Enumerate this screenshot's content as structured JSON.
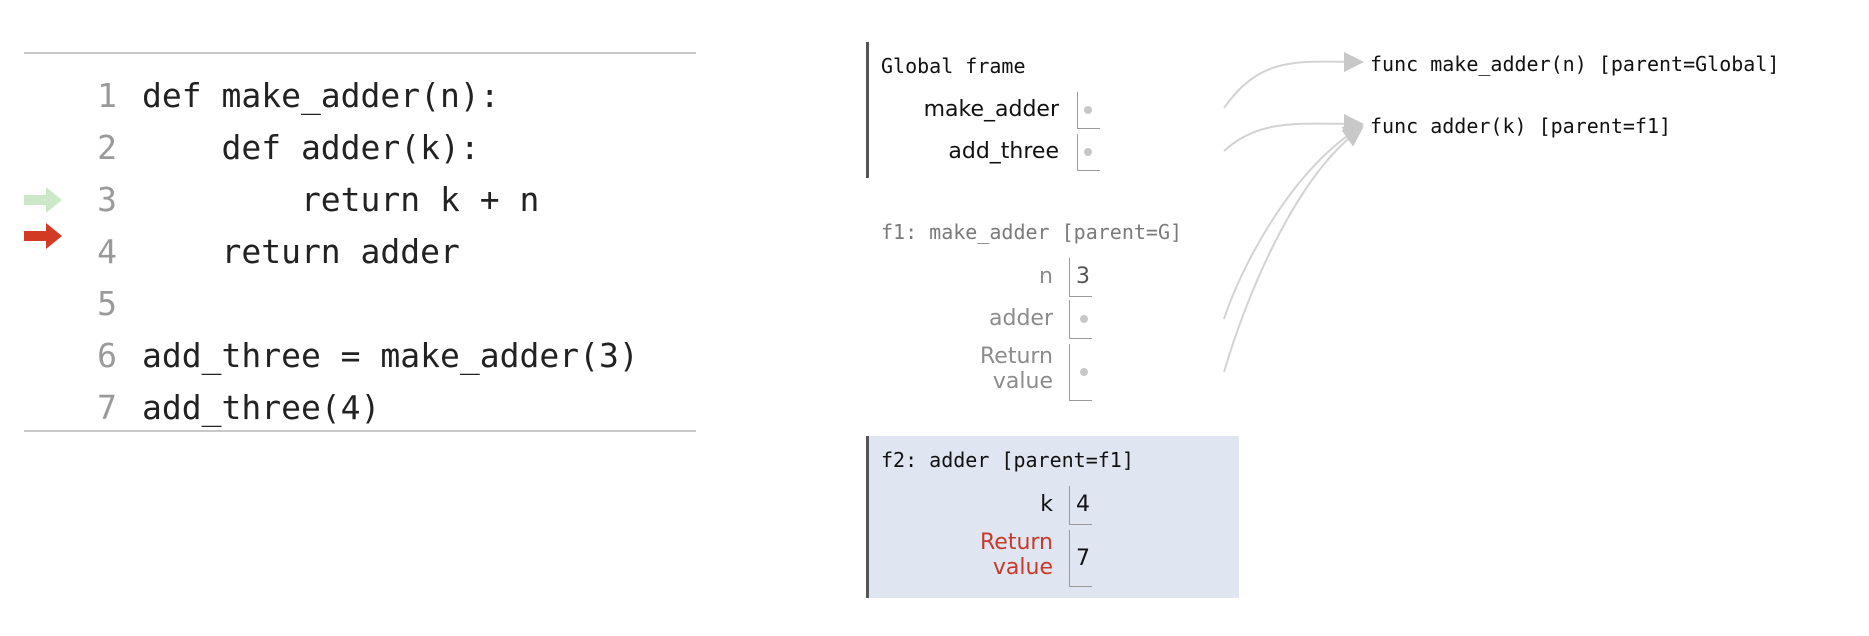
{
  "code": {
    "lines": [
      {
        "num": "1",
        "text": "def make_adder(n):"
      },
      {
        "num": "2",
        "text": "    def adder(k):"
      },
      {
        "num": "3",
        "text": "        return k + n"
      },
      {
        "num": "4",
        "text": "    return adder"
      },
      {
        "num": "5",
        "text": ""
      },
      {
        "num": "6",
        "text": "add_three = make_adder(3)"
      },
      {
        "num": "7",
        "text": "add_three(4)"
      }
    ],
    "prev_line_arrow_color": "#cde8c9",
    "next_line_arrow_color": "#d23a24"
  },
  "global_frame": {
    "title": "Global frame",
    "vars": [
      {
        "name": "make_adder"
      },
      {
        "name": "add_three"
      }
    ]
  },
  "f1_frame": {
    "title": "f1: make_adder [parent=G]",
    "vars": [
      {
        "name": "n",
        "value": "3"
      },
      {
        "name": "adder"
      },
      {
        "name_line1": "Return",
        "name_line2": "value"
      }
    ]
  },
  "f2_frame": {
    "title": "f2: adder [parent=f1]",
    "vars": [
      {
        "name": "k",
        "value": "4"
      },
      {
        "name_line1": "Return",
        "name_line2": "value",
        "value": "7"
      }
    ]
  },
  "heap": {
    "objects": [
      {
        "label": "func make_adder(n) [parent=Global]"
      },
      {
        "label": "func adder(k) [parent=f1]"
      }
    ]
  },
  "colors": {
    "active_frame_bg": "#dfe5f1",
    "return_label_red": "#c9392b",
    "pointer_gray": "#c8c8c8"
  }
}
